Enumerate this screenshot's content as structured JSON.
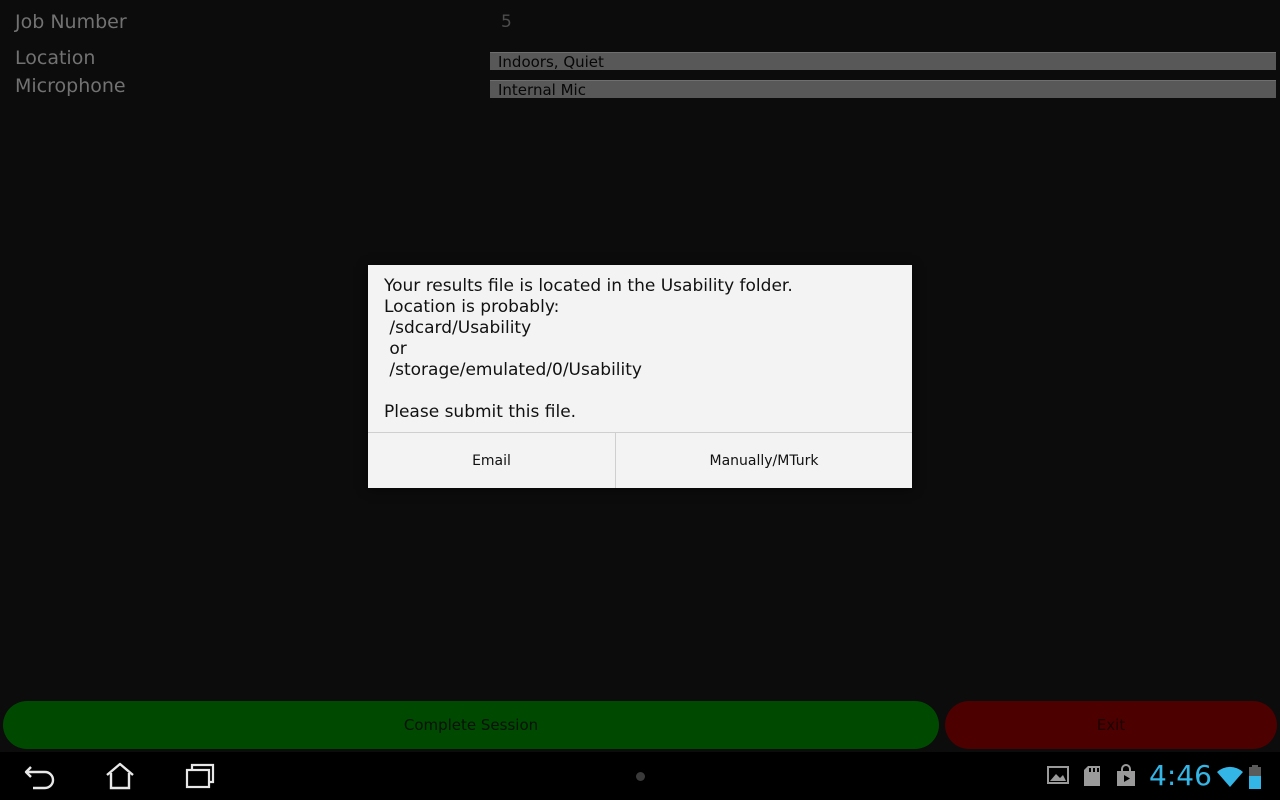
{
  "form": {
    "job_number_label": "Job Number",
    "job_number_value": "5",
    "location_label": "Location",
    "location_value": "Indoors, Quiet",
    "microphone_label": "Microphone",
    "microphone_value": "Internal Mic"
  },
  "dialog": {
    "lines": [
      "Your results file is located in the Usability folder.",
      "Location is probably:",
      " /sdcard/Usability",
      " or",
      " /storage/emulated/0/Usability",
      "",
      "Please submit this file."
    ],
    "email_button": "Email",
    "manual_button": "Manually/MTurk"
  },
  "actions": {
    "complete_label": "Complete Session",
    "exit_label": "Exit",
    "complete_color": "#006600",
    "exit_color": "#6b0000"
  },
  "status_bar": {
    "time": "4:46",
    "accent_color": "#33b5e5",
    "icons": [
      "gallery-icon",
      "sd-card-icon",
      "store-icon",
      "wifi-icon",
      "battery-icon"
    ]
  },
  "navigation": {
    "icons": [
      "back-icon",
      "home-icon",
      "recent-apps-icon"
    ]
  }
}
